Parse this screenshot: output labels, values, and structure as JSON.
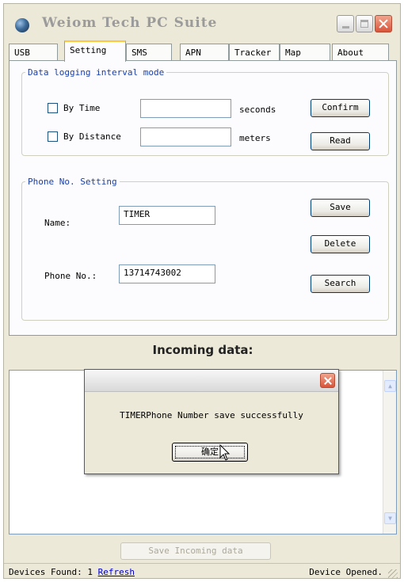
{
  "window": {
    "title": "Weiom Tech PC Suite"
  },
  "tabs": [
    {
      "label": "USB"
    },
    {
      "label": "Setting"
    },
    {
      "label": "SMS"
    },
    {
      "label": "APN"
    },
    {
      "label": "Tracker"
    },
    {
      "label": "Map"
    },
    {
      "label": "About"
    }
  ],
  "active_tab": "Setting",
  "logging": {
    "legend": "Data logging interval mode",
    "by_time_label": "By Time",
    "by_time_checked": false,
    "time_value": "",
    "seconds_label": "seconds",
    "by_distance_label": "By Distance",
    "by_distance_checked": false,
    "distance_value": "",
    "meters_label": "meters",
    "confirm_label": "Confirm",
    "read_label": "Read"
  },
  "phone": {
    "legend": "Phone No. Setting",
    "name_label": "Name:",
    "name_value": "TIMER",
    "phone_label": "Phone No.:",
    "phone_value": "13714743002",
    "save_label": "Save",
    "delete_label": "Delete",
    "search_label": "Search"
  },
  "incoming": {
    "title": "Incoming data:",
    "save_label": "Save Incoming data"
  },
  "status": {
    "devices_text": "Devices Found: 1",
    "refresh_label": "Refresh",
    "device_state": "Device Opened."
  },
  "dialog": {
    "message": "TIMERPhone Number save successfully",
    "ok_label": "确定"
  },
  "icons": [
    "app-globe-icon",
    "minimize-icon",
    "maximize-icon",
    "close-icon",
    "scroll-up-icon",
    "scroll-down-icon",
    "resize-grip-icon",
    "mouse-cursor-icon"
  ]
}
